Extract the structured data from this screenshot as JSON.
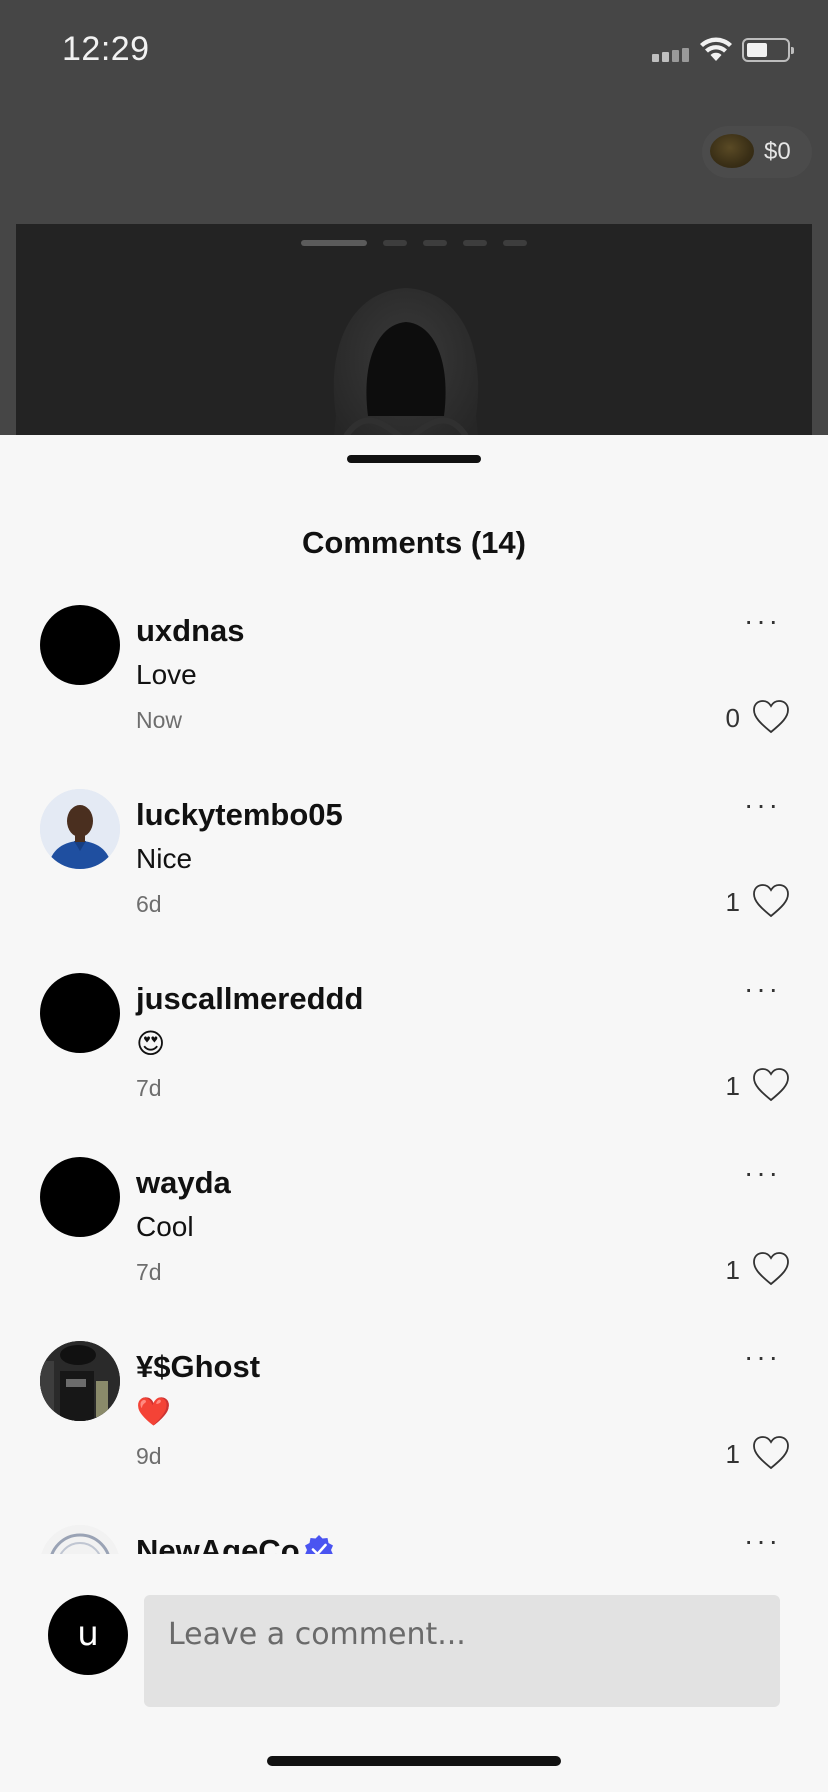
{
  "status_bar": {
    "time": "12:29"
  },
  "wallet": {
    "amount": "$0",
    "coin_icon": "coin-icon"
  },
  "media": {
    "page_count": 5,
    "active_page": 1
  },
  "sheet": {
    "title": "Comments (14)"
  },
  "comments": [
    {
      "username": "uxdnas",
      "text": "Love",
      "time": "Now",
      "likes": "0",
      "avatar": "black"
    },
    {
      "username": "luckytembo05",
      "text": "Nice",
      "time": "6d",
      "likes": "1",
      "avatar": "photo-blue-shirt"
    },
    {
      "username": "juscallmereddd",
      "text": "😍",
      "time": "7d",
      "likes": "1",
      "avatar": "black"
    },
    {
      "username": "wayda",
      "text": "Cool",
      "time": "7d",
      "likes": "1",
      "avatar": "black"
    },
    {
      "username": "¥$Ghost",
      "text": "❤️",
      "time": "9d",
      "likes": "1",
      "avatar": "photo-dark"
    },
    {
      "username": "NewAgeCo",
      "text": "",
      "time": "",
      "likes": "",
      "avatar": "logo",
      "verified": true
    }
  ],
  "more_label": "···",
  "composer": {
    "avatar_letter": "u",
    "placeholder": "Leave a comment..."
  },
  "colors": {
    "sheet_bg": "#f7f7f7",
    "verified_badge": "#4a54f1",
    "input_bg": "#e2e2e2"
  }
}
